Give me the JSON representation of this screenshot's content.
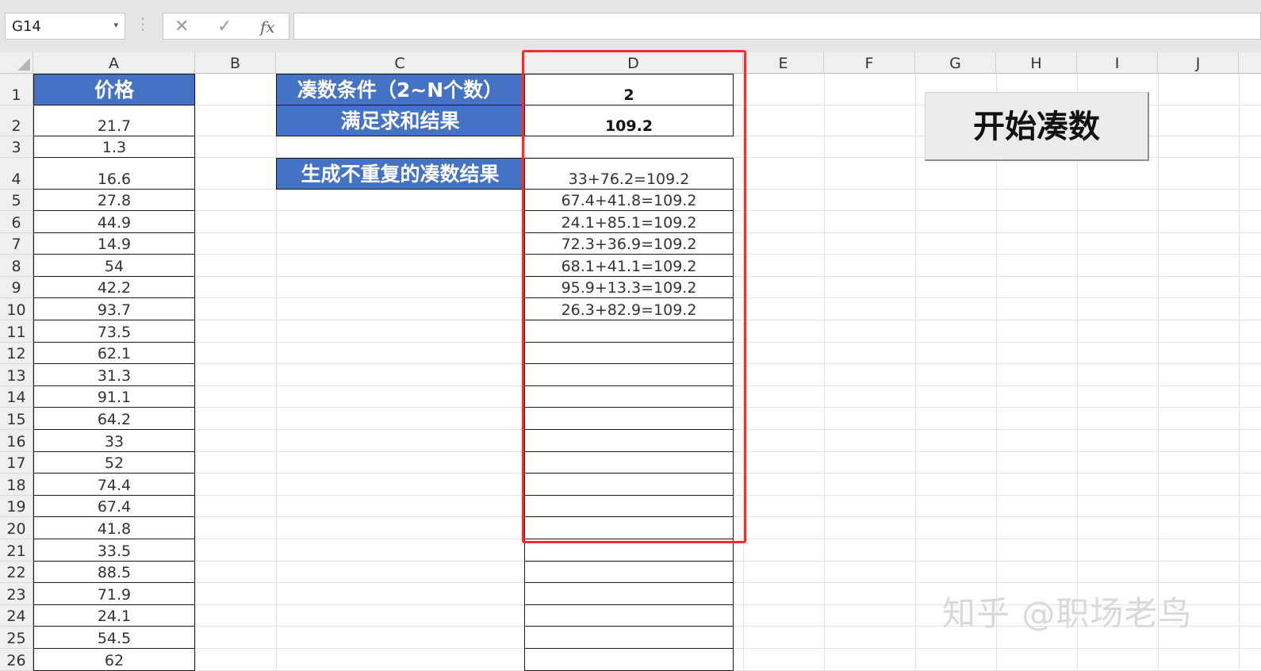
{
  "name_box": {
    "value": "G14",
    "arrow": "▾"
  },
  "formula_bar": {
    "cancel_icon": "✕",
    "enter_icon": "✓",
    "fx_label": "fx",
    "content": ""
  },
  "columns": [
    "A",
    "B",
    "C",
    "D",
    "E",
    "F",
    "G",
    "H",
    "I",
    "J"
  ],
  "rows": [
    "1",
    "2",
    "3",
    "4",
    "5",
    "6",
    "7",
    "8",
    "9",
    "10",
    "11",
    "12",
    "13",
    "14",
    "15",
    "16",
    "17",
    "18",
    "19",
    "20",
    "21",
    "22",
    "23",
    "24",
    "25",
    "26"
  ],
  "column_a": {
    "header": "价格",
    "values": [
      "21.7",
      "1.3",
      "16.6",
      "27.8",
      "44.9",
      "14.9",
      "54",
      "42.2",
      "93.7",
      "73.5",
      "62.1",
      "31.3",
      "91.1",
      "64.2",
      "33",
      "52",
      "74.4",
      "67.4",
      "41.8",
      "33.5",
      "88.5",
      "71.9",
      "24.1",
      "54.5",
      "62"
    ]
  },
  "labels": {
    "condition": "凑数条件（2~N个数）",
    "target": "满足求和结果",
    "results": "生成不重复的凑数结果"
  },
  "column_d": {
    "condition_value": "2",
    "target_value": "109.2",
    "results": [
      "33+76.2=109.2",
      "67.4+41.8=109.2",
      "24.1+85.1=109.2",
      "72.3+36.9=109.2",
      "68.1+41.1=109.2",
      "95.9+13.3=109.2",
      "26.3+82.9=109.2"
    ]
  },
  "start_button": {
    "label": "开始凑数"
  },
  "watermark": "知乎 @职场老鸟",
  "colors": {
    "header_blue": "#4472c4",
    "highlight_red": "#e83333"
  }
}
